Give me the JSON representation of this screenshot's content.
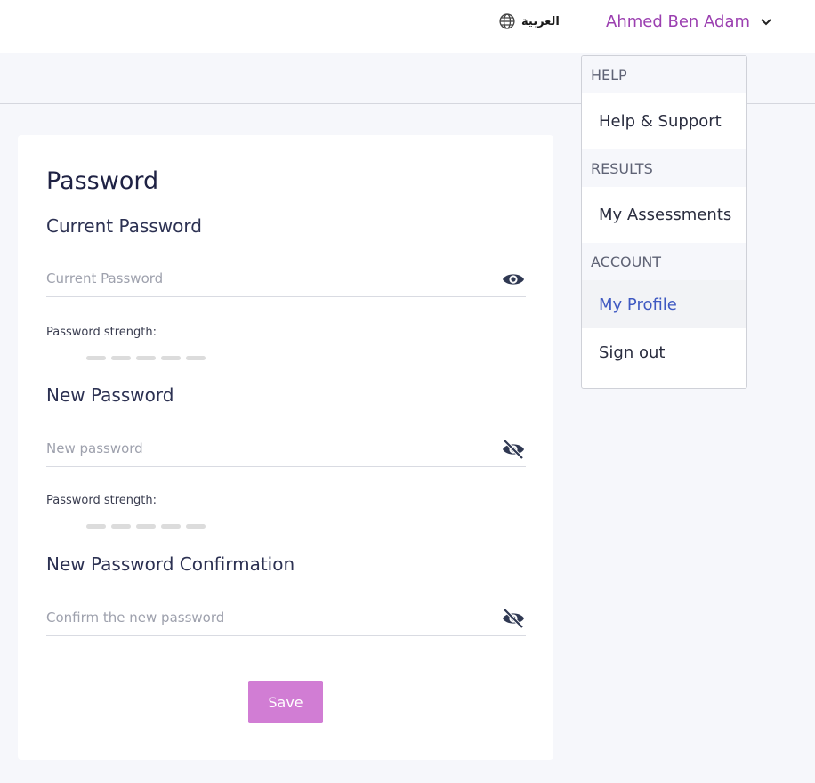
{
  "header": {
    "language_label": "العربية",
    "user_name": "Ahmed Ben Adam"
  },
  "password_card": {
    "title": "Password",
    "current": {
      "label": "Current Password",
      "placeholder": "Current Password",
      "visibility_icon": "eye-icon",
      "strength_label": "Password strength:",
      "strength_level": 0
    },
    "new": {
      "label": "New Password",
      "placeholder": "New password",
      "visibility_icon": "eye-off-icon",
      "strength_label": "Password strength:",
      "strength_level": 0
    },
    "confirm": {
      "label": "New Password Confirmation",
      "placeholder": "Confirm the new password",
      "visibility_icon": "eye-off-icon"
    },
    "save_label": "Save"
  },
  "user_menu": {
    "sections": [
      {
        "header": "HELP",
        "items": [
          "Help & Support"
        ]
      },
      {
        "header": "RESULTS",
        "items": [
          "My Assessments"
        ]
      },
      {
        "header": "ACCOUNT",
        "items": [
          "My Profile",
          "Sign out"
        ]
      }
    ],
    "active_item": "My Profile"
  },
  "colors": {
    "accent_purple": "#9b3fb0",
    "save_button": "#d17dd4",
    "active_link": "#3f59c2"
  }
}
